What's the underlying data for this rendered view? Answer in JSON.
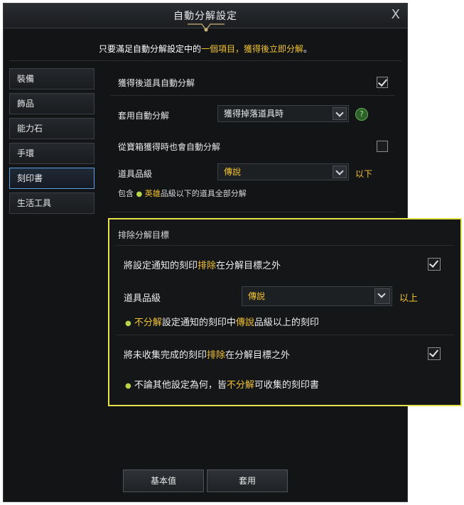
{
  "window": {
    "title": "自動分解設定",
    "close_glyph": "X"
  },
  "notice": {
    "prefix": "只要滿足自動分解設定中的",
    "highlight": "一個項目，獲得後立即分解",
    "suffix": "。"
  },
  "sidebar": {
    "items": [
      {
        "label": "裝備"
      },
      {
        "label": "飾品"
      },
      {
        "label": "能力石"
      },
      {
        "label": "手環"
      },
      {
        "label": "刻印書"
      },
      {
        "label": "生活工具"
      }
    ],
    "active_index": 4
  },
  "settings": {
    "auto_on_obtain_label": "獲得後道具自動分解",
    "auto_on_obtain_checked": true,
    "apply_label": "套用自動分解",
    "apply_value": "獲得掉落道具時",
    "help_glyph": "?",
    "chest_label": "從寶箱獲得時也會自動分解",
    "chest_checked": false,
    "grade_label": "道具品級",
    "grade_value": "傳說",
    "grade_suffix": "以下",
    "include_prefix": "包含",
    "include_highlight": "英雄",
    "include_suffix": "品級以下的道具全部分解"
  },
  "exclude": {
    "title": "排除分解目標",
    "row1_prefix": "將設定通知的刻印",
    "row1_highlight": "排除",
    "row1_suffix": "在分解目標之外",
    "row1_checked": true,
    "grade_label": "道具品級",
    "grade_value": "傳說",
    "grade_suffix": "以上",
    "note1_hl1": "不分解",
    "note1_mid": "設定通知的刻印中",
    "note1_hl2": "傳說",
    "note1_suffix": "品級以上的刻印",
    "row2_prefix": "將未收集完成的刻印",
    "row2_highlight": "排除",
    "row2_suffix": "在分解目標之外",
    "row2_checked": true,
    "note2_prefix": "不論其他設定為何，皆",
    "note2_highlight": "不分解",
    "note2_suffix": "可收集的刻印書"
  },
  "buttons": {
    "default_label": "基本值",
    "apply_label": "套用"
  },
  "colors": {
    "accent_yellow": "#f2c233",
    "highlight_border": "#e6e34a",
    "active_tab_border": "#5aa0e0"
  }
}
